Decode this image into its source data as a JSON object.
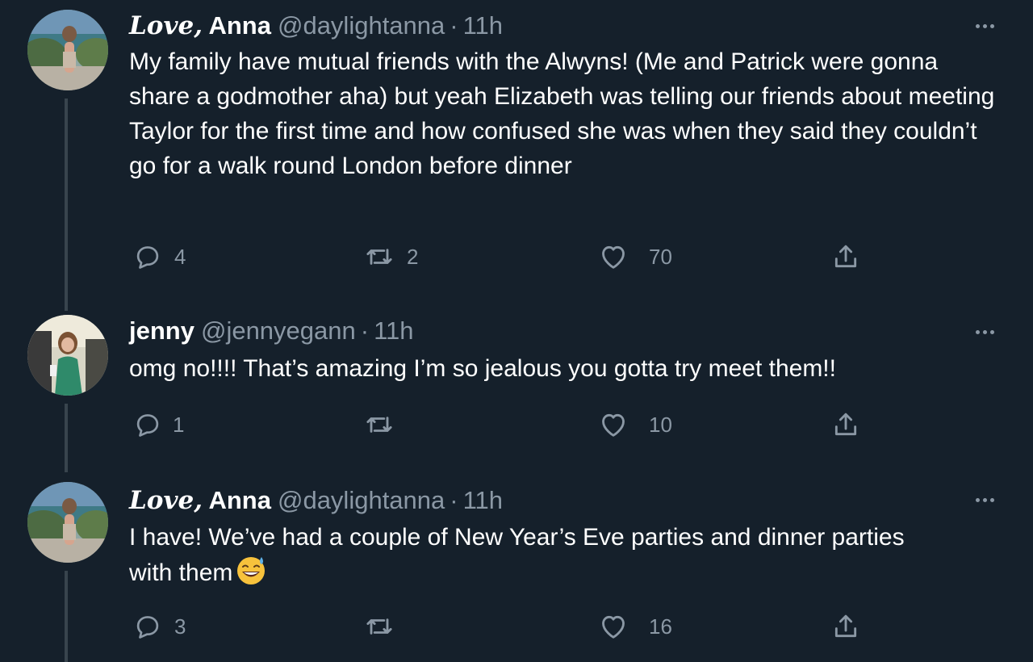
{
  "tweets": [
    {
      "name_script": "Love,",
      "name_plain": " Anna",
      "handle": "@daylightanna",
      "separator": "·",
      "time": "11h",
      "text": "My family have mutual friends with the Alwyns! (Me and Patrick were gonna share a godmother aha) but yeah Elizabeth was telling our friends about meeting Taylor for the first time and how confused she was when they said they couldn’t go for a walk round London before dinner",
      "reply_count": "4",
      "retweet_count": "2",
      "like_count": "70"
    },
    {
      "name_plain": "jenny",
      "handle": "@jennyegann",
      "separator": "·",
      "time": "11h",
      "text": "omg no!!!! That’s amazing I’m so jealous you gotta try meet them!!",
      "reply_count": "1",
      "retweet_count": "",
      "like_count": "10"
    },
    {
      "name_script": "Love,",
      "name_plain": " Anna",
      "handle": "@daylightanna",
      "separator": "·",
      "time": "11h",
      "text": "I have! We’ve had a couple of New Year’s Eve parties and dinner parties with them",
      "emoji": "grinning-face-with-sweat",
      "reply_count": "3",
      "retweet_count": "",
      "like_count": "16"
    }
  ],
  "icons": [
    "more-icon",
    "reply-icon",
    "retweet-icon",
    "like-icon",
    "share-icon"
  ],
  "colors": {
    "background": "#15202b",
    "text": "#ffffff",
    "secondary": "#8b98a5",
    "thread_line": "#38444d"
  }
}
